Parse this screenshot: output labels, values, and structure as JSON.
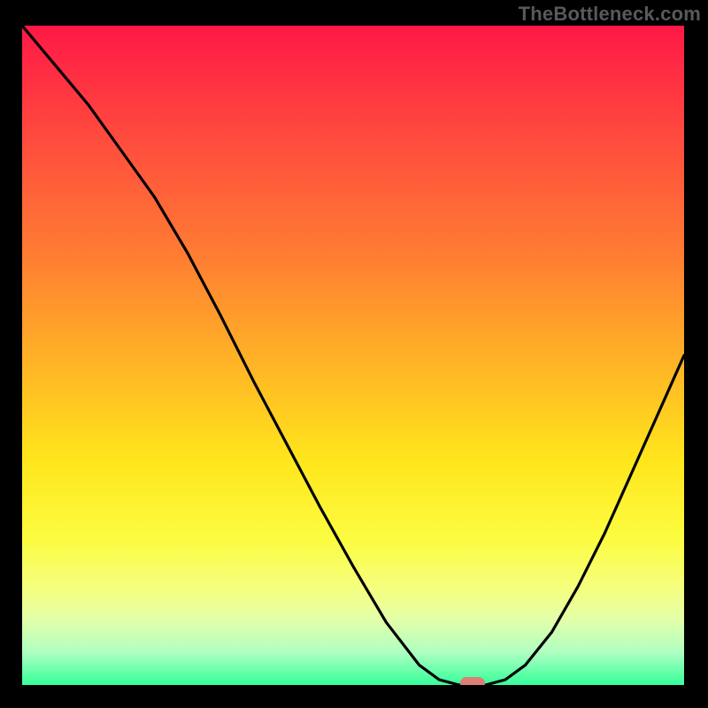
{
  "watermark": "TheBottleneck.com",
  "colors": {
    "top": "#ff1846",
    "mid": "#ffe61c",
    "bottom": "#35ff9a",
    "curve": "#000000",
    "marker": "#de7e79",
    "frame": "#000000"
  },
  "chart_data": {
    "type": "line",
    "title": "",
    "xlabel": "",
    "ylabel": "",
    "xlim": [
      0,
      100
    ],
    "ylim": [
      0,
      100
    ],
    "series": [
      {
        "name": "bottleneck-curve",
        "x": [
          0,
          5,
          10,
          15,
          20,
          25,
          30,
          35,
          40,
          45,
          50,
          55,
          60,
          63,
          66,
          70,
          73,
          76,
          80,
          84,
          88,
          92,
          96,
          100
        ],
        "values": [
          100,
          94,
          88,
          81,
          74,
          65.5,
          56,
          46,
          36.5,
          27,
          18,
          9.5,
          3,
          0.8,
          0,
          0,
          0.8,
          3,
          8,
          15,
          23,
          32,
          41,
          50
        ]
      }
    ],
    "annotations": [
      {
        "type": "marker",
        "shape": "rounded-rect",
        "x": 68,
        "y": 0,
        "color": "#de7e79"
      }
    ],
    "background_gradient": {
      "direction": "vertical",
      "stops": [
        {
          "pos": 0.0,
          "color": "#ff1846"
        },
        {
          "pos": 0.17,
          "color": "#ff4b3e"
        },
        {
          "pos": 0.34,
          "color": "#ff7a33"
        },
        {
          "pos": 0.51,
          "color": "#ffb326"
        },
        {
          "pos": 0.66,
          "color": "#ffe61c"
        },
        {
          "pos": 0.78,
          "color": "#fcfc41"
        },
        {
          "pos": 0.85,
          "color": "#f6ff7c"
        },
        {
          "pos": 0.9,
          "color": "#e4ffa8"
        },
        {
          "pos": 0.95,
          "color": "#b0ffc2"
        },
        {
          "pos": 1.0,
          "color": "#35ff9a"
        }
      ]
    }
  }
}
